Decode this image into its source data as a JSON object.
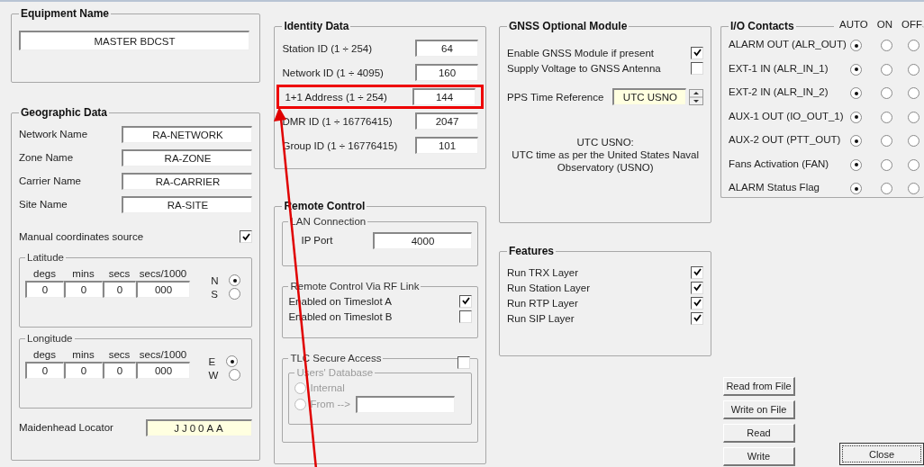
{
  "equipment": {
    "title": "Equipment Name",
    "value": "MASTER BDCST"
  },
  "geographic": {
    "title": "Geographic Data",
    "fields": [
      {
        "label": "Network Name",
        "value": "RA-NETWORK"
      },
      {
        "label": "Zone Name",
        "value": "RA-ZONE"
      },
      {
        "label": "Carrier Name",
        "value": "RA-CARRIER"
      },
      {
        "label": "Site Name",
        "value": "RA-SITE"
      }
    ],
    "manual": {
      "label": "Manual coordinates source",
      "checked": true
    },
    "coords": [
      {
        "title": "Latitude",
        "columns": [
          "degs",
          "mins",
          "secs",
          "secs/1000"
        ],
        "values": [
          "0",
          "0",
          "0",
          "000"
        ],
        "hemispheres": [
          {
            "label": "N",
            "selected": true
          },
          {
            "label": "S",
            "selected": false
          }
        ]
      },
      {
        "title": "Longitude",
        "columns": [
          "degs",
          "mins",
          "secs",
          "secs/1000"
        ],
        "values": [
          "0",
          "0",
          "0",
          "000"
        ],
        "hemispheres": [
          {
            "label": "E",
            "selected": true
          },
          {
            "label": "W",
            "selected": false
          }
        ]
      }
    ],
    "locator": {
      "label": "Maidenhead Locator",
      "value": "JJ00AA"
    }
  },
  "identity": {
    "title": "Identity Data",
    "rows": [
      {
        "label": "Station ID (1 ÷ 254)",
        "value": "64",
        "highlighted": false
      },
      {
        "label": "Network ID (1 ÷ 4095)",
        "value": "160",
        "highlighted": false
      },
      {
        "label": "1+1 Address (1 ÷ 254)",
        "value": "144",
        "highlighted": true
      },
      {
        "label": "DMR ID (1 ÷ 16776415)",
        "value": "2047",
        "highlighted": false
      },
      {
        "label": "Group ID (1 ÷ 16776415)",
        "value": "101",
        "highlighted": false
      }
    ]
  },
  "remote": {
    "title": "Remote Control",
    "lan": {
      "title": "LAN Connection",
      "label": "IP Port",
      "value": "4000"
    },
    "rf": {
      "title": "Remote Control Via RF Link",
      "options": [
        {
          "label": "Enabled on Timeslot A",
          "checked": true
        },
        {
          "label": "Enabled on Timeslot B",
          "checked": false
        }
      ]
    },
    "tlc": {
      "title": "TLC Secure Access",
      "checked": false,
      "database": {
        "title": "Users' Database",
        "disabled": true,
        "options": [
          {
            "label": "Internal",
            "selected": false
          },
          {
            "label": "From -->",
            "selected": false
          }
        ]
      }
    }
  },
  "gnss": {
    "title": "GNSS Optional Module",
    "options": [
      {
        "label": "Enable GNSS Module if present",
        "checked": true
      },
      {
        "label": "Supply Voltage to GNSS Antenna",
        "checked": false
      }
    ],
    "pps": {
      "label": "PPS Time Reference",
      "value": "UTC USNO"
    },
    "note_title": "UTC USNO:",
    "note": "UTC time as per the United States Naval Observatory (USNO)"
  },
  "features": {
    "title": "Features",
    "options": [
      {
        "label": "Run TRX Layer",
        "checked": true
      },
      {
        "label": "Run Station Layer",
        "checked": true
      },
      {
        "label": "Run RTP Layer",
        "checked": true
      },
      {
        "label": "Run SIP Layer",
        "checked": true
      }
    ]
  },
  "io": {
    "title": "I/O Contacts",
    "modes": [
      "AUTO",
      "ON",
      "OFF"
    ],
    "rows": [
      {
        "label": "ALARM OUT (ALR_OUT)",
        "options": [
          {
            "selected": true
          },
          {
            "selected": false
          },
          {
            "selected": false
          }
        ]
      },
      {
        "label": "EXT-1 IN (ALR_IN_1)",
        "options": [
          {
            "selected": true
          },
          {
            "selected": false
          },
          {
            "selected": false
          }
        ]
      },
      {
        "label": "EXT-2 IN (ALR_IN_2)",
        "options": [
          {
            "selected": true
          },
          {
            "selected": false
          },
          {
            "selected": false
          }
        ]
      },
      {
        "label": "AUX-1 OUT (IO_OUT_1)",
        "options": [
          {
            "selected": true
          },
          {
            "selected": false
          },
          {
            "selected": false
          }
        ]
      },
      {
        "label": "AUX-2 OUT (PTT_OUT)",
        "options": [
          {
            "selected": true
          },
          {
            "selected": false
          },
          {
            "selected": false
          }
        ]
      },
      {
        "label": "Fans Activation (FAN)",
        "options": [
          {
            "selected": true
          },
          {
            "selected": false
          },
          {
            "selected": false
          }
        ]
      },
      {
        "label": "ALARM Status Flag",
        "options": [
          {
            "selected": true
          },
          {
            "selected": false
          },
          {
            "selected": false
          }
        ]
      }
    ]
  },
  "buttons": [
    "Read from File",
    "Write on File",
    "Read",
    "Write"
  ],
  "close": {
    "label": "Close",
    "focused": true
  },
  "annotation": {
    "arrow": true
  }
}
